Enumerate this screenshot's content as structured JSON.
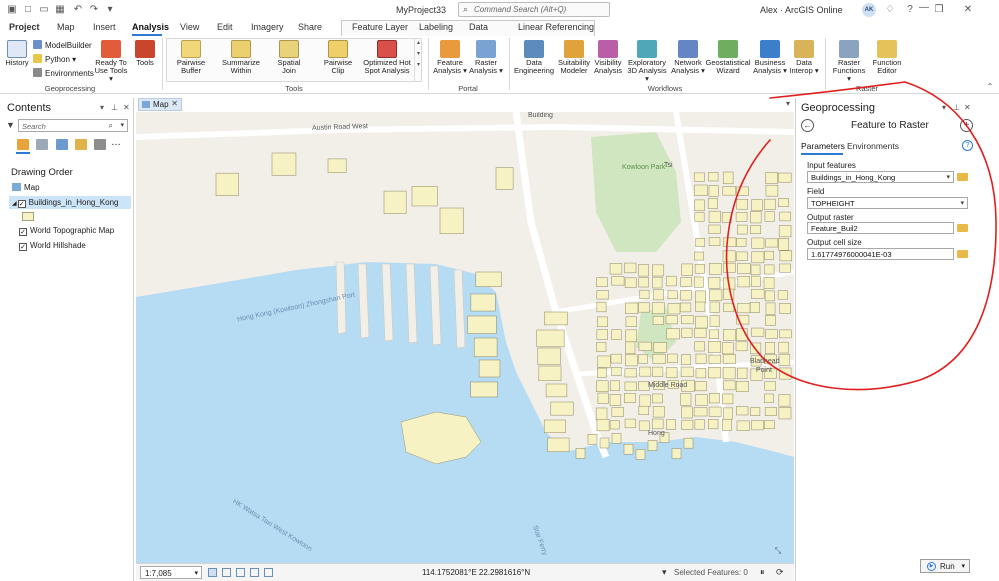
{
  "app": {
    "doc_title": "MyProject33",
    "search_placeholder": "Command Search (Alt+Q)",
    "user": "Alex  ·  ArcGIS Online",
    "avatar_initials": "AK",
    "accent_color": "#2b7bd4"
  },
  "ribbon_tabs": [
    "Project",
    "Map",
    "Insert",
    "Analysis",
    "View",
    "Edit",
    "Imagery",
    "Share",
    "Feature Layer",
    "Labeling",
    "Data",
    "Linear Referencing"
  ],
  "active_tab": "Analysis",
  "ribbon": {
    "geoprocessing": {
      "label": "Geoprocessing",
      "history": "History",
      "modelbuilder": "ModelBuilder",
      "python": "Python",
      "environments": "Environments",
      "ready_to_use": [
        "Ready To",
        "Use Tools"
      ],
      "tools": "Tools"
    },
    "tools_group": {
      "label": "Tools",
      "items": [
        [
          "Pairwise",
          "Buffer"
        ],
        [
          "Summarize",
          "Within"
        ],
        [
          "Spatial",
          "Join"
        ],
        [
          "Pairwise",
          "Clip"
        ],
        [
          "Optimized Hot",
          "Spot Analysis"
        ]
      ]
    },
    "portal": {
      "label": "Portal",
      "items": [
        [
          "Feature",
          "Analysis"
        ],
        [
          "Raster",
          "Analysis"
        ]
      ]
    },
    "workflows": {
      "label": "Workflows",
      "items": [
        [
          "Data",
          "Engineering"
        ],
        [
          "Suitability",
          "Modeler"
        ],
        [
          "Visibility",
          "Analysis"
        ],
        [
          "Exploratory",
          "3D Analysis"
        ],
        [
          "Network",
          "Analysis"
        ],
        [
          "Geostatistical",
          "Wizard"
        ],
        [
          "Business",
          "Analysis"
        ],
        [
          "Data",
          "Interop"
        ]
      ]
    },
    "raster": {
      "label": "Raster",
      "items": [
        [
          "Raster",
          "Functions"
        ],
        [
          "Function",
          "Editor"
        ]
      ]
    }
  },
  "contents": {
    "title": "Contents",
    "search_placeholder": "Search",
    "drawing_order": "Drawing Order",
    "map": "Map",
    "layers": [
      "Buildings_in_Hong_Kong",
      "World Topographic Map",
      "World Hillshade"
    ]
  },
  "map_view": {
    "tab_label": "Map",
    "labels": {
      "austin_road_west": "Austin Road West",
      "building": "Building",
      "kowloon_park": "Kowloon Park",
      "tsim": "Tsi",
      "hk_kowloon_ferry": "Hong Kong (Kowloon) Zhongshan Port",
      "middle_road": "Middle Road",
      "bladhead": "Bladhead",
      "point": "Point",
      "wai_ferry": "HK Watsa Taxi West Kowloon",
      "star_ferry": "Star Ferry",
      "hon": "Hong"
    },
    "scale": "1:7,085",
    "coordinates": "114.1752081°E 22.2981616°N",
    "selected_features": "Selected Features: 0"
  },
  "geoprocessing": {
    "pane_title": "Geoprocessing",
    "tool_name": "Feature to Raster",
    "tabs": [
      "Parameters",
      "Environments"
    ],
    "active_tab": "Parameters",
    "params": [
      {
        "label": "Input features",
        "value": "Buildings_in_Hong_Kong",
        "kind": "dropdown-folder"
      },
      {
        "label": "Field",
        "value": "TOPHEIGHT",
        "kind": "dropdown"
      },
      {
        "label": "Output raster",
        "value": "Feature_Buil2",
        "kind": "folder"
      },
      {
        "label": "Output cell size",
        "value": "1.61774976000041E-03",
        "kind": "folder"
      }
    ],
    "run_label": "Run"
  },
  "annotation_color": "#e02020"
}
